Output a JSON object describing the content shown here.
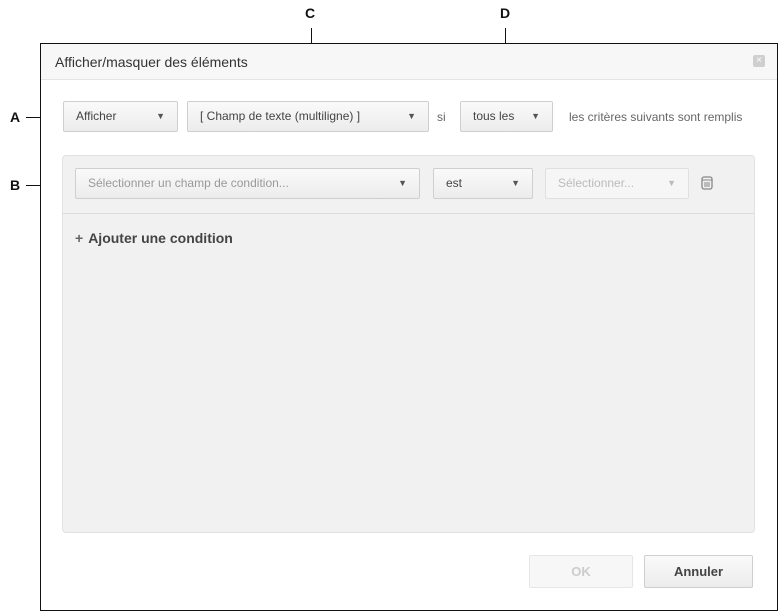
{
  "callouts": {
    "a": "A",
    "b": "B",
    "c": "C",
    "d": "D"
  },
  "dialog": {
    "title": "Afficher/masquer des éléments",
    "close_icon": "×",
    "rule": {
      "action": "Afficher",
      "target": "[ Champ de texte (multiligne) ]",
      "si": "si",
      "quantifier": "tous les",
      "suffix": "les critères suivants sont remplis"
    },
    "condition": {
      "field_placeholder": "Sélectionner un champ de condition...",
      "operator": "est",
      "value_placeholder": "Sélectionner..."
    },
    "add_condition": "Ajouter une condition",
    "buttons": {
      "ok": "OK",
      "cancel": "Annuler"
    }
  }
}
